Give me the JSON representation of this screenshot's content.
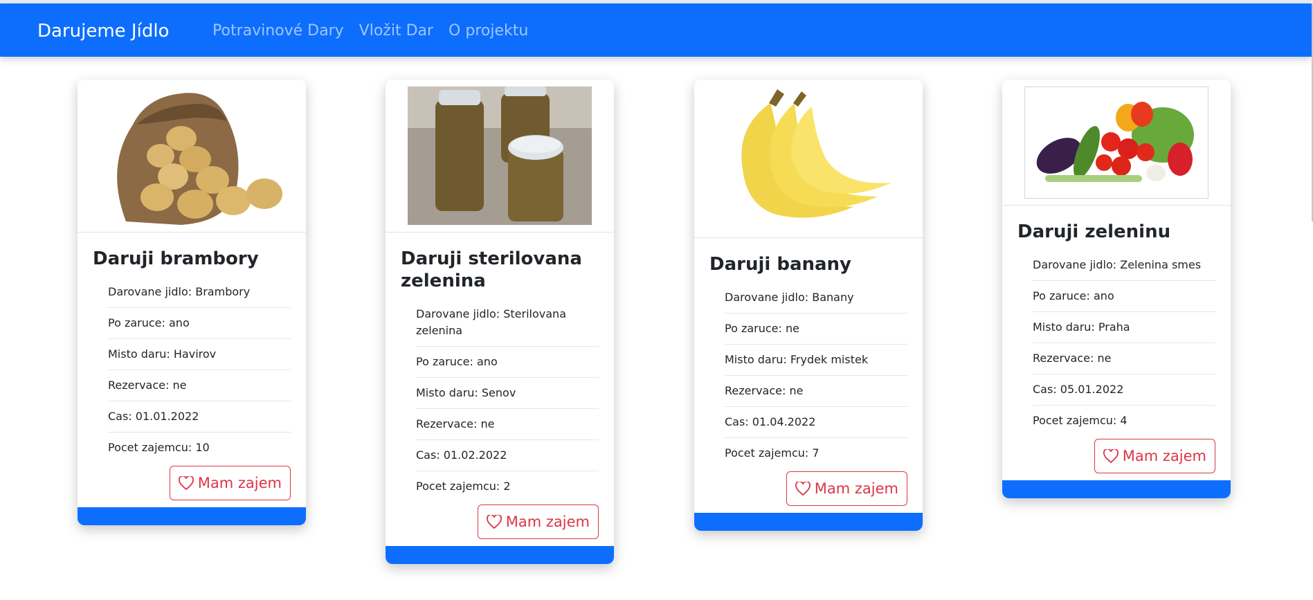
{
  "navbar": {
    "brand": "Darujeme Jídlo",
    "links": [
      "Potravinové Dary",
      "Vložit Dar",
      "O projektu"
    ]
  },
  "cards": [
    {
      "image": "potatoes-image",
      "title": "Daruji brambory",
      "details": [
        "Darovane jidlo: Brambory",
        "Po zaruce: ano",
        "Misto daru: Havirov",
        "Rezervace: ne",
        "Cas: 01.01.2022",
        "Pocet zajemcu: 10"
      ],
      "button": "Mam zajem"
    },
    {
      "image": "jars-image",
      "title": "Daruji sterilovana zelenina",
      "details": [
        "Darovane jidlo: Sterilovana zelenina",
        "Po zaruce: ano",
        "Misto daru: Senov",
        "Rezervace: ne",
        "Cas: 01.02.2022",
        "Pocet zajemcu: 2"
      ],
      "button": "Mam zajem"
    },
    {
      "image": "bananas-image",
      "title": "Daruji banany",
      "details": [
        "Darovane jidlo: Banany",
        "Po zaruce: ne",
        "Misto daru: Frydek mistek",
        "Rezervace: ne",
        "Cas: 01.04.2022",
        "Pocet zajemcu: 7"
      ],
      "button": "Mam zajem"
    },
    {
      "image": "vegetables-image",
      "title": "Daruji zeleninu",
      "details": [
        "Darovane jidlo: Zelenina smes",
        "Po zaruce: ano",
        "Misto daru: Praha",
        "Rezervace: ne",
        "Cas: 05.01.2022",
        "Pocet zajemcu: 4"
      ],
      "button": "Mam zajem"
    }
  ],
  "colors": {
    "primary": "#0d6efd",
    "danger": "#dc3545"
  },
  "icons": {
    "button": "heart-icon"
  }
}
